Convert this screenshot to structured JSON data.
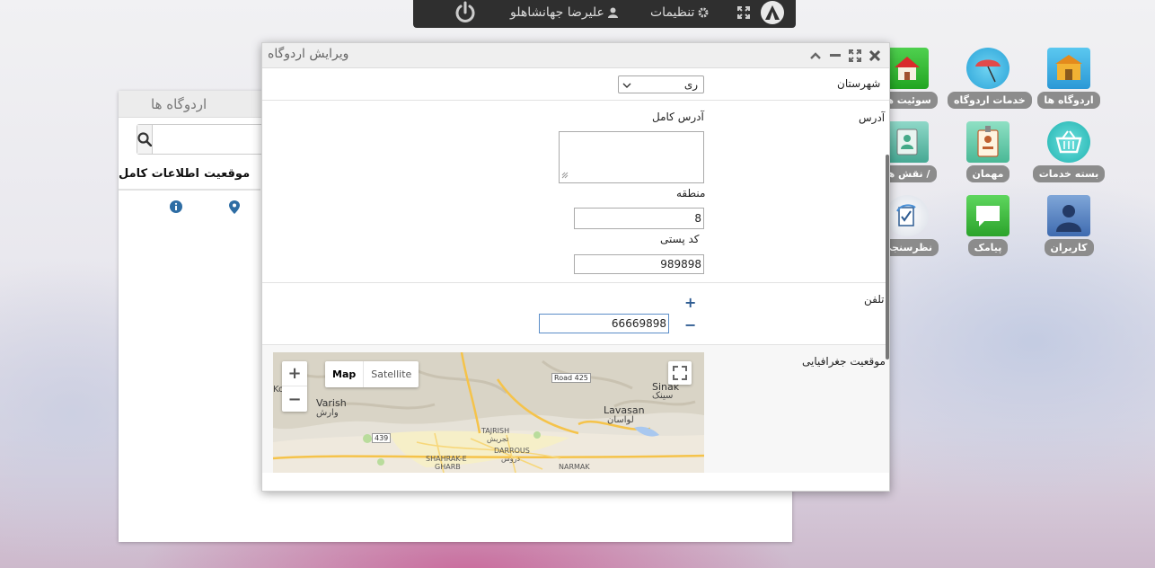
{
  "topbar": {
    "user_name": "علیرضا جهانشاهلو",
    "settings_label": "تنظیمات"
  },
  "list_window": {
    "title": "اردوگاه ها",
    "columns": [
      "موقعیت",
      "اطلاعات کامل"
    ]
  },
  "desktop_icons": [
    {
      "label": "اردوگاه ها",
      "icon": "camp-icon"
    },
    {
      "label": "خدمات اردوگاه",
      "icon": "umbrella-icon"
    },
    {
      "label": "سوئیت ها",
      "icon": "house-icon"
    },
    {
      "label": "بسته خدمات",
      "icon": "basket-icon"
    },
    {
      "label": "مهمان",
      "icon": "id-badge-icon"
    },
    {
      "label": "نقش ها / ",
      "icon": "role-icon"
    },
    {
      "label": "کاربران",
      "icon": "user-icon"
    },
    {
      "label": "پیامک",
      "icon": "message-icon"
    },
    {
      "label": "نظرسنجی",
      "icon": "survey-icon"
    }
  ],
  "dialog": {
    "title": "ویرایش اردوگاه",
    "city_label": "شهرستان",
    "city_value": "ری",
    "address_label": "آدرس",
    "full_address_label": "آدرس کامل",
    "full_address_value": "",
    "region_label": "منطقه",
    "region_value": "8",
    "postal_label": "کد پستی",
    "postal_value": "989898",
    "phone_label": "تلفن",
    "phone_value": "66669898",
    "geo_label": "موقعیت جغرافیایی"
  },
  "map": {
    "map_button": "Map",
    "satellite_button": "Satellite",
    "labels": {
      "varish_en": "Varish",
      "varish_fa": "وارش",
      "lavasan_en": "Lavasan",
      "lavasan_fa": "لواسان",
      "sinak_en": "Sinak",
      "sinak_fa": "سینک",
      "tajrish_en": "TAJRISH",
      "tajrish_fa": "تجریش",
      "darrous_en": "DARROUS",
      "darrous_fa": "دروس",
      "shahrak_en": "SHAHRAK-E",
      "gharb_en": "GHARB",
      "narmak_en": "NARMAK",
      "ko": "Ko"
    },
    "roads": [
      "Road 425",
      "439"
    ]
  },
  "colors": {
    "accent_blue": "#2e6da4",
    "label_gray": "#8c8c8c",
    "topbar": "#2f2f2f"
  }
}
